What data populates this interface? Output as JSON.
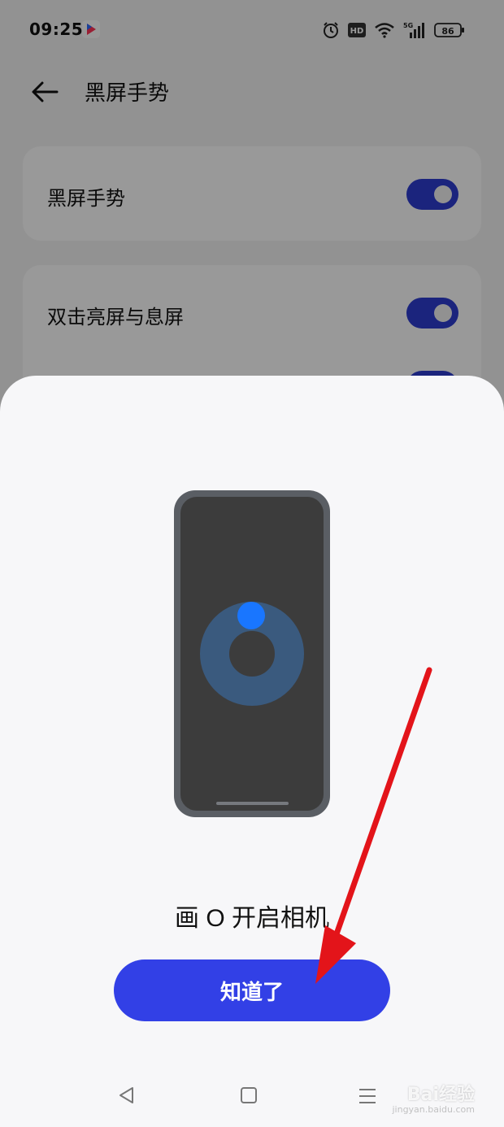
{
  "status_bar": {
    "time": "09:25",
    "icons": [
      "app-icon",
      "alarm-icon",
      "hd-icon",
      "wifi-icon",
      "5g-signal-icon",
      "battery-icon"
    ],
    "battery": "86"
  },
  "header": {
    "title": "黑屏手势"
  },
  "settings": {
    "row1_label": "黑屏手势",
    "row2_label": "双击亮屏与息屏"
  },
  "sheet": {
    "caption": "画 O 开启相机",
    "confirm_label": "知道了"
  },
  "watermark": {
    "text": "Bai经验",
    "sub": "jingyan.baidu.com"
  },
  "colors": {
    "accent": "#3240e6",
    "toggle": "#2d3dd1",
    "annotation_arrow": "#e3141a",
    "gesture_dot": "#1976ff"
  }
}
